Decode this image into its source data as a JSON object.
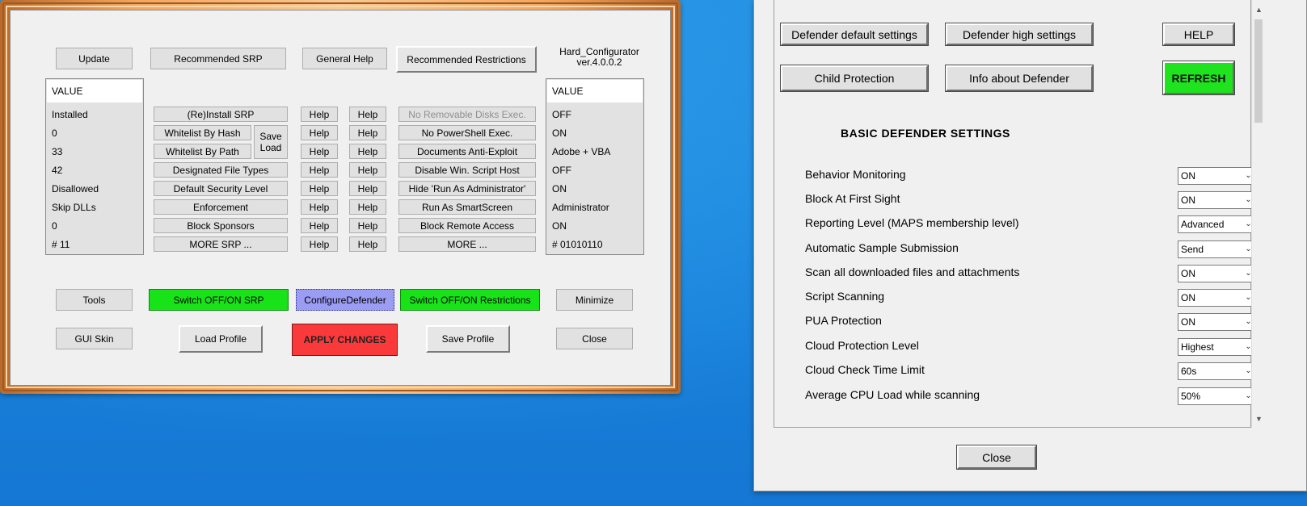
{
  "hc": {
    "update": "Update",
    "recommended_srp": "Recommended SRP",
    "general_help": "General Help",
    "recommended_restrictions": "Recommended Restrictions",
    "app_title_line1": "Hard_Configurator",
    "app_title_line2": "ver.4.0.0.2",
    "left_values": {
      "header": "VALUE",
      "rows": [
        "Installed",
        "0",
        "33",
        "42",
        "Disallowed",
        "Skip DLLs",
        "0",
        "# 11"
      ]
    },
    "srp_buttons": [
      "(Re)Install SRP",
      "Whitelist By Hash",
      "Whitelist By Path",
      "Designated File Types",
      "Default Security Level",
      "Enforcement",
      "Block Sponsors",
      "MORE SRP ..."
    ],
    "save_load": {
      "line1": "Save",
      "line2": "Load"
    },
    "help_label": "Help",
    "restriction_buttons": [
      "No Removable Disks Exec.",
      "No PowerShell Exec.",
      "Documents Anti-Exploit",
      "Disable Win. Script Host",
      "Hide  'Run As Administrator'",
      "Run As SmartScreen",
      "Block Remote Access",
      "MORE ..."
    ],
    "right_values": {
      "header": "VALUE",
      "rows": [
        "OFF",
        "ON",
        "Adobe + VBA",
        "OFF",
        "ON",
        "Administrator",
        "ON",
        "# 01010110"
      ]
    },
    "tools": "Tools",
    "switch_srp": "Switch OFF/ON SRP",
    "configure_defender": "ConfigureDefender",
    "switch_restrictions": "Switch OFF/ON Restrictions",
    "minimize": "Minimize",
    "gui_skin": "GUI Skin",
    "load_profile": "Load Profile",
    "apply_changes": "APPLY CHANGES",
    "save_profile": "Save Profile",
    "close": "Close",
    "colors": {
      "green": "#18e318",
      "blue": "#9b9cf4",
      "red": "#fa3a3a",
      "frame": "#f2a760"
    }
  },
  "defender": {
    "default_settings": "Defender default settings",
    "high_settings": "Defender high settings",
    "help": "HELP",
    "child_protection": "Child Protection",
    "info": "Info about Defender",
    "refresh": "REFRESH",
    "section_title": "BASIC  DEFENDER  SETTINGS",
    "settings": [
      {
        "label": "Behavior Monitoring",
        "value": "ON"
      },
      {
        "label": "Block At First Sight",
        "value": "ON"
      },
      {
        "label": "Reporting Level (MAPS membership level)",
        "value": "Advanced"
      },
      {
        "label": "Automatic Sample Submission",
        "value": "Send"
      },
      {
        "label": "Scan all downloaded files and attachments",
        "value": "ON"
      },
      {
        "label": "Script Scanning",
        "value": "ON"
      },
      {
        "label": "PUA Protection",
        "value": "ON"
      },
      {
        "label": "Cloud Protection Level",
        "value": "Highest"
      },
      {
        "label": "Cloud Check Time Limit",
        "value": "60s"
      },
      {
        "label": "Average CPU Load while scanning",
        "value": "50%"
      }
    ],
    "close": "Close",
    "colors": {
      "refresh": "#1ee31e"
    }
  },
  "icons": {
    "dropdown": "chevron-down-icon",
    "scroll_up": "scroll-up-icon",
    "scroll_down": "scroll-down-icon"
  }
}
